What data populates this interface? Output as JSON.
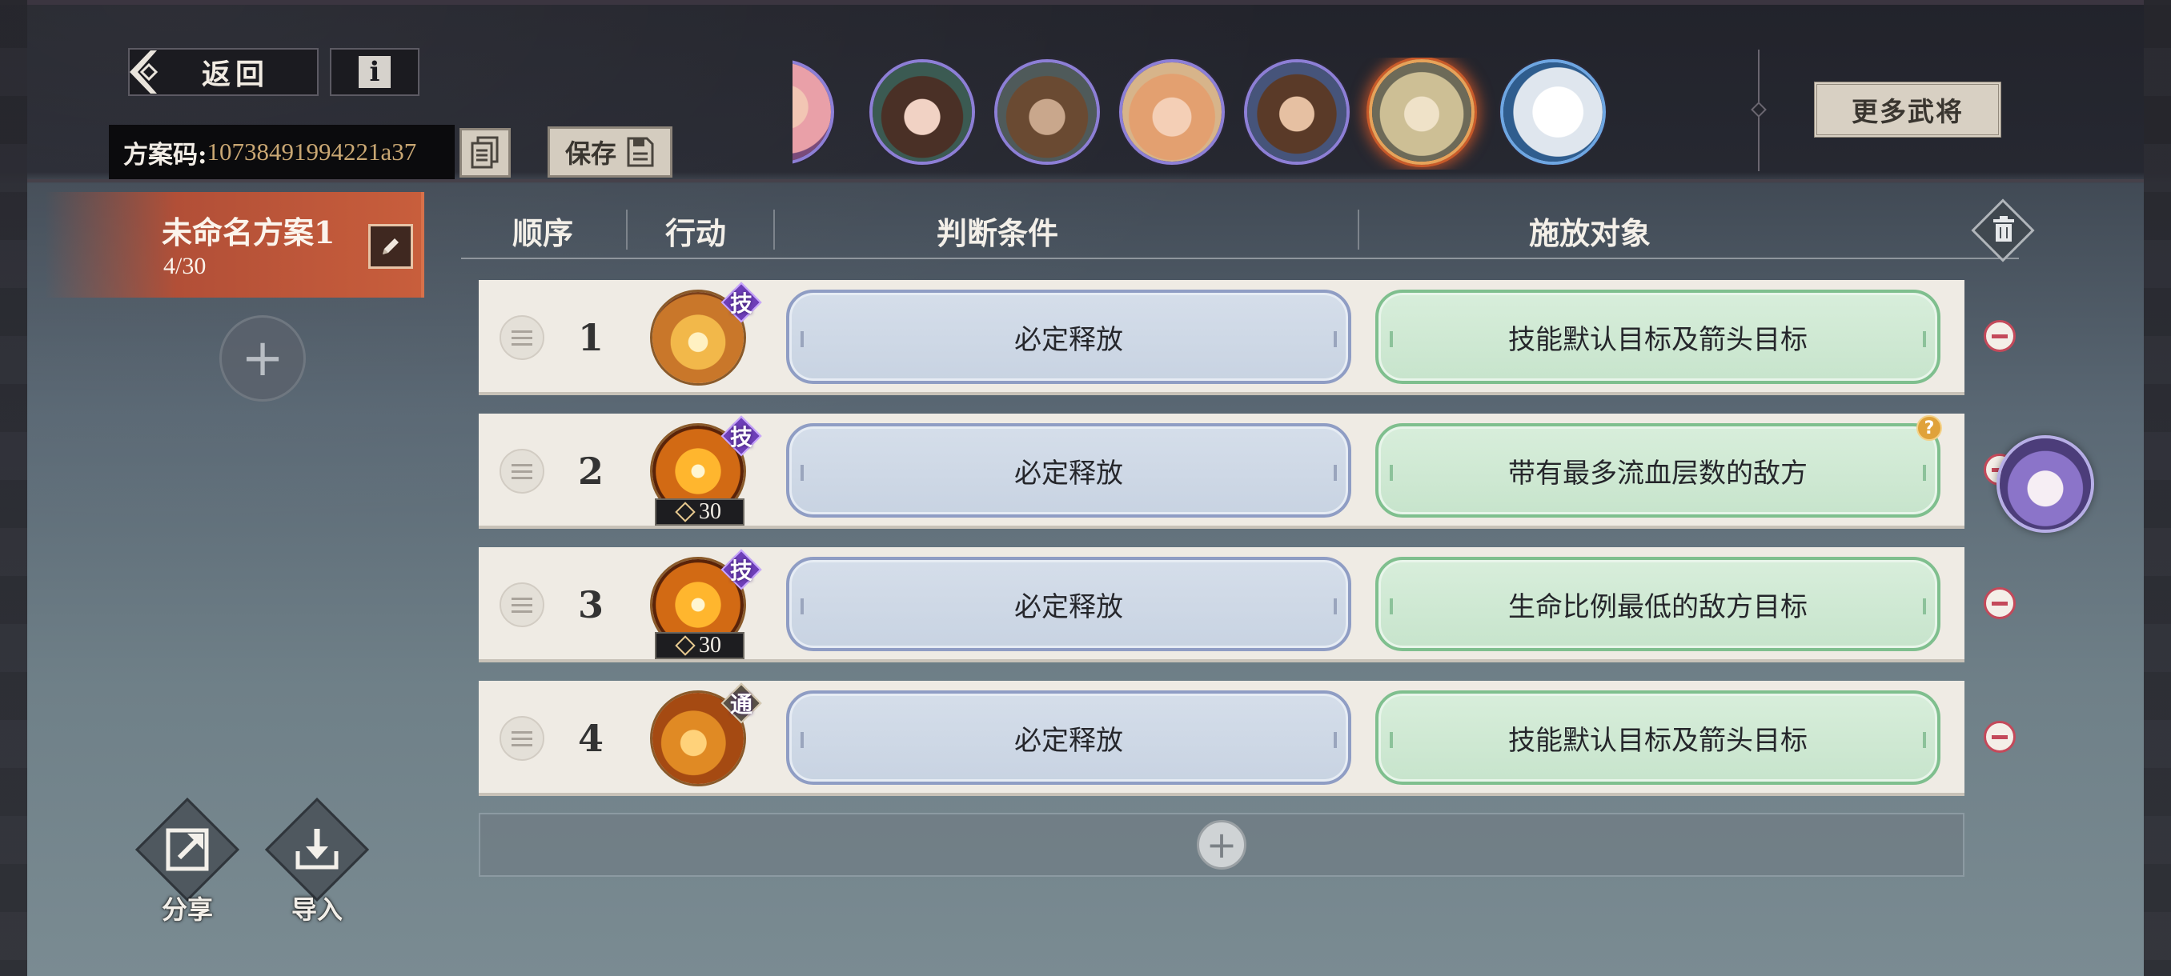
{
  "nav": {
    "back_label": "返回",
    "info_label": "i"
  },
  "scheme_code": {
    "label": "方案码:",
    "value": "10738491994221a37"
  },
  "save_label": "保存",
  "more_heroes_label": "更多武将",
  "heroes": [
    {
      "name": "hero-1",
      "ring": "purple",
      "selected": false
    },
    {
      "name": "hero-2",
      "ring": "purple",
      "selected": false
    },
    {
      "name": "hero-3",
      "ring": "purple",
      "selected": false
    },
    {
      "name": "hero-4",
      "ring": "purple",
      "selected": false
    },
    {
      "name": "hero-5",
      "ring": "purple",
      "selected": false
    },
    {
      "name": "hero-6",
      "ring": "gold",
      "selected": true
    },
    {
      "name": "hero-7",
      "ring": "blue",
      "selected": false
    }
  ],
  "scheme": {
    "name": "未命名方案1",
    "count": "4/30"
  },
  "tools": {
    "share_label": "分享",
    "import_label": "导入"
  },
  "table": {
    "headers": {
      "order": "顺序",
      "action": "行动",
      "condition": "判断条件",
      "target": "施放对象"
    },
    "rows": [
      {
        "order": "1",
        "skill_tag": "技",
        "cost": "",
        "condition": "必定释放",
        "target": "技能默认目标及箭头目标"
      },
      {
        "order": "2",
        "skill_tag": "技",
        "cost": "30",
        "condition": "必定释放",
        "target": "带有最多流血层数的敌方"
      },
      {
        "order": "3",
        "skill_tag": "技",
        "cost": "30",
        "condition": "必定释放",
        "target": "生命比例最低的敌方目标"
      },
      {
        "order": "4",
        "skill_tag": "通",
        "cost": "",
        "condition": "必定释放",
        "target": "技能默认目标及箭头目标"
      }
    ]
  },
  "help_mark": "?",
  "colors": {
    "scheme_card": "#c85e3c",
    "condition_fill": "#d5deea",
    "target_fill": "#d8eedb",
    "remove_red": "#c4495a"
  }
}
